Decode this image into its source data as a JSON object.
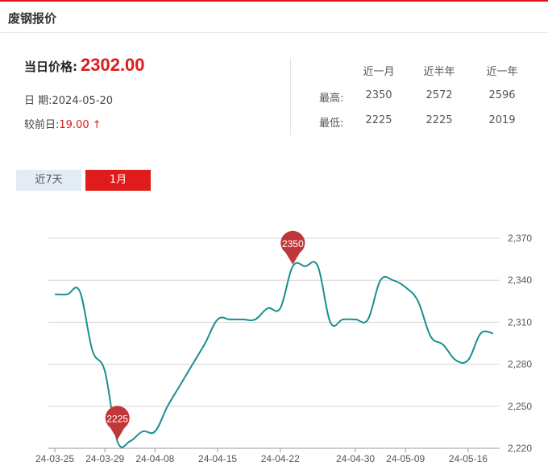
{
  "header": {
    "title": "废钢报价"
  },
  "price": {
    "label": "当日价格:",
    "value": "2302.00"
  },
  "date": {
    "label": "日 期:",
    "value": "2024-05-20"
  },
  "change": {
    "label": "较前日:",
    "value": "19.00 ↑"
  },
  "stats": {
    "columns": [
      "近一月",
      "近半年",
      "近一年"
    ],
    "rows": [
      {
        "label": "最高:",
        "values": [
          "2350",
          "2572",
          "2596"
        ]
      },
      {
        "label": "最低:",
        "values": [
          "2225",
          "2225",
          "2019"
        ]
      }
    ]
  },
  "tabs": {
    "seven_days": "近7天",
    "one_month": "1月"
  },
  "colors": {
    "accent": "#e01b1b",
    "line": "#1a8f8f",
    "marker": "#c0373a"
  },
  "chart_data": {
    "type": "line",
    "x_tick_labels": [
      "24-03-25",
      "24-03-29",
      "24-04-08",
      "24-04-15",
      "24-04-22",
      "24-04-30",
      "24-05-09",
      "24-05-16"
    ],
    "y_tick_labels": [
      "2,220",
      "2,250",
      "2,280",
      "2,310",
      "2,340",
      "2,370"
    ],
    "ylim": [
      2220,
      2370
    ],
    "grid": true,
    "series": [
      {
        "x": [
          "24-03-25",
          "24-03-26",
          "24-03-27",
          "24-03-28",
          "24-03-29",
          "24-04-01",
          "24-04-02",
          "24-04-03",
          "24-04-08",
          "24-04-09",
          "24-04-10",
          "24-04-11",
          "24-04-12",
          "24-04-15",
          "24-04-16",
          "24-04-17",
          "24-04-18",
          "24-04-19",
          "24-04-22",
          "24-04-23",
          "24-04-24",
          "24-04-25",
          "24-04-26",
          "24-04-29",
          "24-04-30",
          "24-05-06",
          "24-05-07",
          "24-05-08",
          "24-05-09",
          "24-05-10",
          "24-05-13",
          "24-05-14",
          "24-05-15",
          "24-05-16",
          "24-05-17",
          "24-05-20"
        ],
        "values": [
          2330,
          2330,
          2332,
          2290,
          2275,
          2225,
          2225,
          2232,
          2232,
          2250,
          2265,
          2280,
          2295,
          2312,
          2312,
          2312,
          2312,
          2320,
          2320,
          2350,
          2350,
          2350,
          2310,
          2312,
          2312,
          2312,
          2340,
          2340,
          2335,
          2325,
          2300,
          2294,
          2283,
          2283,
          2302,
          2302
        ]
      }
    ],
    "markers": [
      {
        "label": "2350",
        "x": "24-04-23",
        "value": 2350
      },
      {
        "label": "2225",
        "x": "24-04-01",
        "value": 2225
      }
    ]
  }
}
